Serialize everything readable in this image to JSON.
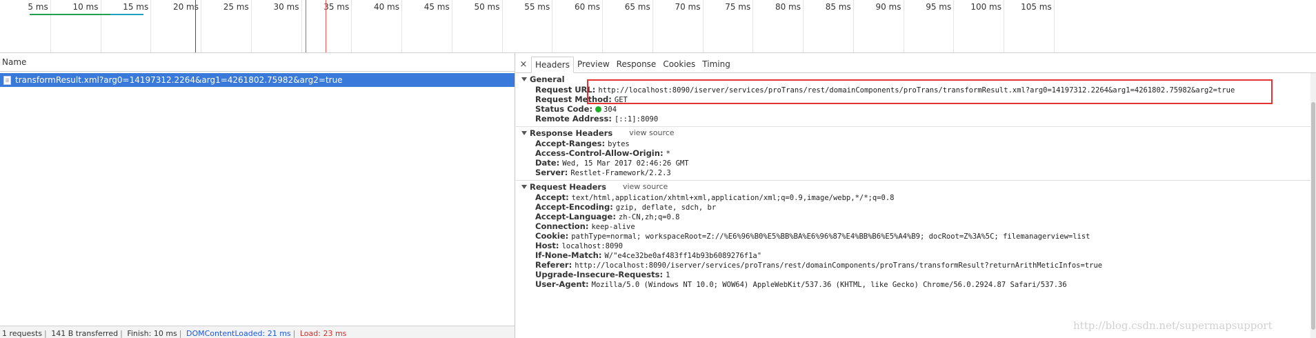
{
  "overview": {
    "ticks": [
      {
        "label": "5 ms",
        "ms": 5
      },
      {
        "label": "10 ms",
        "ms": 10
      },
      {
        "label": "15 ms",
        "ms": 15
      },
      {
        "label": "20 ms",
        "ms": 20
      },
      {
        "label": "25 ms",
        "ms": 25
      },
      {
        "label": "30 ms",
        "ms": 30
      },
      {
        "label": "35 ms",
        "ms": 35
      },
      {
        "label": "40 ms",
        "ms": 40
      },
      {
        "label": "45 ms",
        "ms": 45
      },
      {
        "label": "50 ms",
        "ms": 50
      },
      {
        "label": "55 ms",
        "ms": 55
      },
      {
        "label": "60 ms",
        "ms": 60
      },
      {
        "label": "65 ms",
        "ms": 65
      },
      {
        "label": "70 ms",
        "ms": 70
      },
      {
        "label": "75 ms",
        "ms": 75
      },
      {
        "label": "80 ms",
        "ms": 80
      },
      {
        "label": "85 ms",
        "ms": 85
      },
      {
        "label": "90 ms",
        "ms": 90
      },
      {
        "label": "95 ms",
        "ms": 95
      },
      {
        "label": "100 ms",
        "ms": 100
      },
      {
        "label": "105 ms",
        "ms": 105
      }
    ],
    "event_lines": [
      {
        "name": "finish-line",
        "ms": 10,
        "color": "#1f4fd6"
      },
      {
        "name": "domcontentloaded-line",
        "ms": 21,
        "color": "#6b6bff"
      },
      {
        "name": "load-line",
        "ms": 23,
        "color": "#ff5757"
      }
    ],
    "colors": {
      "waterfall_green": "#20a050",
      "waterfall_teal": "#1ea0c0"
    }
  },
  "list": {
    "header": "Name",
    "request_name": "transformResult.xml?arg0=14197312.2264&arg1=4261802.75982&arg2=true"
  },
  "status_bar": {
    "requests": "1 requests",
    "transferred": "141 B transferred",
    "finish": "Finish: 10 ms",
    "dcl": "DOMContentLoaded: 21 ms",
    "load": "Load: 23 ms"
  },
  "tabs": {
    "close": "×",
    "headers": "Headers",
    "preview": "Preview",
    "response": "Response",
    "cookies": "Cookies",
    "timing": "Timing"
  },
  "general": {
    "title": "General",
    "request_url_key": "Request URL:",
    "request_url": "http://localhost:8090/iserver/services/proTrans/rest/domainComponents/proTrans/transformResult.xml?arg0=14197312.2264&arg1=4261802.75982&arg2=true",
    "method_key": "Request Method:",
    "method": "GET",
    "status_key": "Status Code:",
    "status": "304",
    "remote_key": "Remote Address:",
    "remote": "[::1]:8090"
  },
  "response_headers": {
    "title": "Response Headers",
    "view_source": "view source",
    "items": [
      {
        "k": "Accept-Ranges:",
        "v": "bytes"
      },
      {
        "k": "Access-Control-Allow-Origin:",
        "v": "*"
      },
      {
        "k": "Date:",
        "v": "Wed, 15 Mar 2017 02:46:26 GMT"
      },
      {
        "k": "Server:",
        "v": "Restlet-Framework/2.2.3"
      }
    ]
  },
  "request_headers": {
    "title": "Request Headers",
    "view_source": "view source",
    "items": [
      {
        "k": "Accept:",
        "v": "text/html,application/xhtml+xml,application/xml;q=0.9,image/webp,*/*;q=0.8"
      },
      {
        "k": "Accept-Encoding:",
        "v": "gzip, deflate, sdch, br"
      },
      {
        "k": "Accept-Language:",
        "v": "zh-CN,zh;q=0.8"
      },
      {
        "k": "Connection:",
        "v": "keep-alive"
      },
      {
        "k": "Cookie:",
        "v": "pathType=normal; workspaceRoot=Z://%E6%96%B0%E5%BB%BA%E6%96%87%E4%BB%B6%E5%A4%B9; docRoot=Z%3A%5C; filemanagerview=list"
      },
      {
        "k": "Host:",
        "v": "localhost:8090"
      },
      {
        "k": "If-None-Match:",
        "v": "W/\"e4ce32be0af483ff14b93b6089276f1a\""
      },
      {
        "k": "Referer:",
        "v": "http://localhost:8090/iserver/services/proTrans/rest/domainComponents/proTrans/transformResult?returnArithMeticInfos=true"
      },
      {
        "k": "Upgrade-Insecure-Requests:",
        "v": "1"
      },
      {
        "k": "User-Agent:",
        "v": "Mozilla/5.0 (Windows NT 10.0; WOW64) AppleWebKit/537.36 (KHTML, like Gecko) Chrome/56.0.2924.87 Safari/537.36"
      }
    ]
  },
  "watermark": "http://blog.csdn.net/supermapsupport"
}
